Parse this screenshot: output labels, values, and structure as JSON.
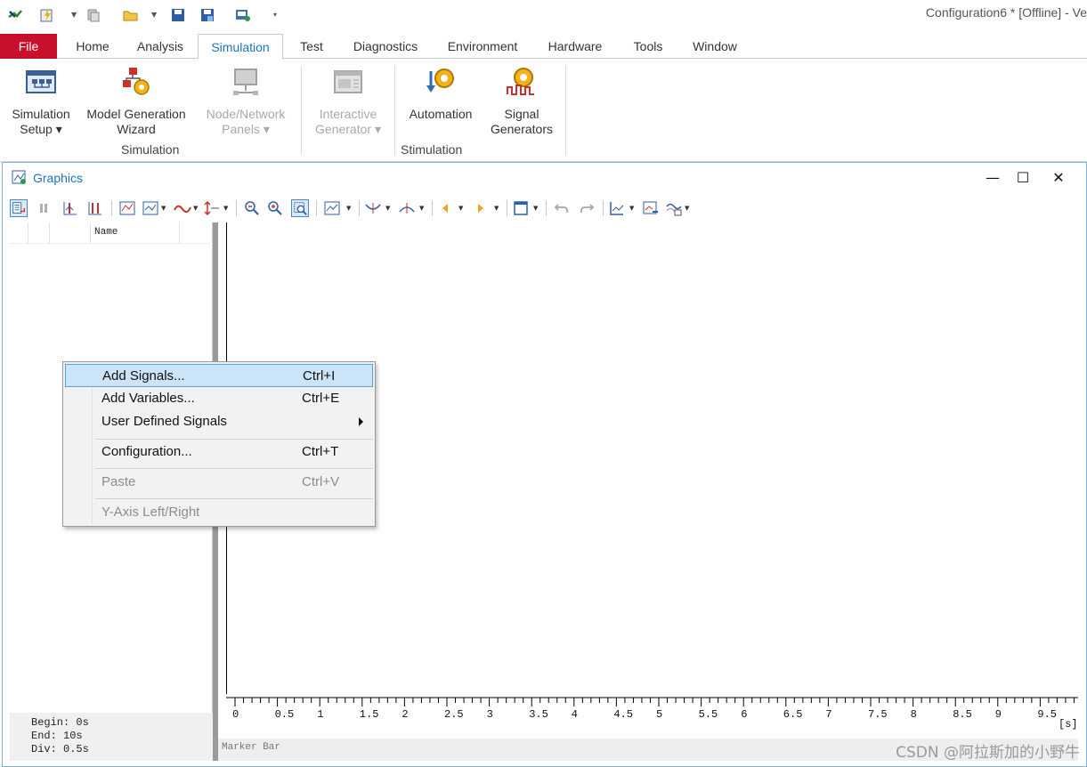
{
  "app": {
    "title": "Configuration6 * [Offline] - Ve"
  },
  "tabs": [
    {
      "label": "File"
    },
    {
      "label": "Home"
    },
    {
      "label": "Analysis"
    },
    {
      "label": "Simulation"
    },
    {
      "label": "Test"
    },
    {
      "label": "Diagnostics"
    },
    {
      "label": "Environment"
    },
    {
      "label": "Hardware"
    },
    {
      "label": "Tools"
    },
    {
      "label": "Window"
    }
  ],
  "ribbon": {
    "buttons": [
      {
        "line1": "Simulation",
        "line2": "Setup ▾",
        "icon": "simulation-setup-icon",
        "enabled": true
      },
      {
        "line1": "Model Generation",
        "line2": "Wizard",
        "icon": "model-wizard-icon",
        "enabled": true
      },
      {
        "line1": "Node/Network",
        "line2": "Panels ▾",
        "icon": "node-panels-icon",
        "enabled": false
      },
      {
        "line1": "Interactive",
        "line2": "Generator ▾",
        "icon": "interactive-generator-icon",
        "enabled": false
      },
      {
        "line1": "Automation",
        "line2": "",
        "icon": "automation-icon",
        "enabled": true
      },
      {
        "line1": "Signal",
        "line2": "Generators",
        "icon": "signal-generators-icon",
        "enabled": true
      }
    ],
    "groups": [
      {
        "label": "Simulation"
      },
      {
        "label": "Stimulation"
      }
    ]
  },
  "graphics": {
    "title": "Graphics",
    "list_header": "Name",
    "info": {
      "begin": "Begin: 0s",
      "end": "End: 10s",
      "div": "Div: 0.5s"
    },
    "x_ticks": [
      "0",
      "0.5",
      "1",
      "1.5",
      "2",
      "2.5",
      "3",
      "3.5",
      "4",
      "4.5",
      "5",
      "5.5",
      "6",
      "6.5",
      "7",
      "7.5",
      "8",
      "8.5",
      "9",
      "9.5"
    ],
    "x_unit": "[s]",
    "marker_bar": "Marker Bar"
  },
  "context_menu": [
    {
      "label": "Add Signals...",
      "shortcut": "Ctrl+I",
      "selected": true,
      "disabled": false
    },
    {
      "label": "Add Variables...",
      "shortcut": "Ctrl+E",
      "selected": false,
      "disabled": false
    },
    {
      "label": "User Defined Signals",
      "shortcut": "",
      "submenu": true,
      "disabled": false
    },
    {
      "label": "Configuration...",
      "shortcut": "Ctrl+T",
      "selected": false,
      "disabled": false
    },
    {
      "label": "Paste",
      "shortcut": "Ctrl+V",
      "selected": false,
      "disabled": true
    },
    {
      "label": "Y-Axis Left/Right",
      "shortcut": "",
      "selected": false,
      "disabled": true
    }
  ],
  "watermark": "CSDN @阿拉斯加的小野牛",
  "colors": {
    "file_tab": "#c8102e",
    "accent": "#1e73be",
    "menu_highlight": "#cce4f7"
  }
}
